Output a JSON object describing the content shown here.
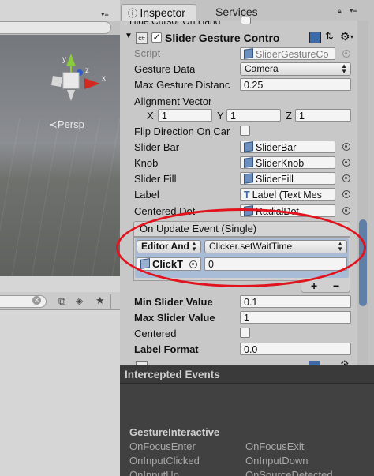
{
  "inspector": {
    "tabs": {
      "inspector": "Inspector",
      "services": "Services"
    },
    "hidden_cursor_label": "Hide Cursor On Hand",
    "component": {
      "title": "Slider Gesture Contro",
      "script_label": "Script",
      "script_value": "SliderGestureCo",
      "gesture_data_label": "Gesture Data",
      "gesture_data_value": "Camera",
      "max_gesture_label": "Max Gesture Distanc",
      "max_gesture_value": "0.25",
      "alignment_label": "Alignment Vector",
      "alignment": {
        "x_label": "X",
        "x": "1",
        "y_label": "Y",
        "y": "1",
        "z_label": "Z",
        "z": "1"
      },
      "flip_label": "Flip Direction On Car",
      "slider_bar_label": "Slider Bar",
      "slider_bar_value": "SliderBar",
      "knob_label": "Knob",
      "knob_value": "SliderKnob",
      "slider_fill_label": "Slider Fill",
      "slider_fill_value": "SliderFill",
      "label_label": "Label",
      "label_value": "Label (Text Mes",
      "centered_dot_label": "Centered Dot",
      "centered_dot_value": "RadialDot"
    },
    "event": {
      "header": "On Update Event (Single)",
      "runtime_value": "Editor And",
      "function_value": "Clicker.setWaitTime",
      "object_value": "ClickT",
      "arg_value": "0",
      "add_label": "+",
      "remove_label": "−"
    },
    "slider_settings": {
      "min_label": "Min Slider Value",
      "min_value": "0.1",
      "max_label": "Max Slider Value",
      "max_value": "1",
      "centered_label": "Centered",
      "format_label": "Label Format",
      "format_value": "0.0"
    }
  },
  "scene": {
    "persp_label": "≺Persp"
  },
  "intercepted": {
    "title": "Intercepted Events",
    "section": "GestureInteractive",
    "events": [
      "OnFocusEnter",
      "OnFocusExit",
      "OnInputClicked",
      "OnInputDown",
      "OnInputUp",
      "OnSourceDetected"
    ]
  },
  "colors": {
    "highlight": "#e1141e",
    "ie_background": "#414141"
  }
}
